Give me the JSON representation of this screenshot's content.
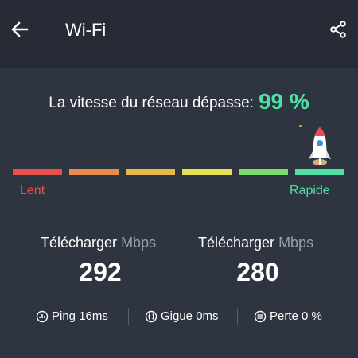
{
  "header": {
    "title": "Wi-Fi",
    "back_icon": "arrow-left-icon",
    "share_icon": "share-icon"
  },
  "speed": {
    "headline": "La vitesse du réseau dépasse:",
    "percent": "99 %",
    "percent_color": "#4fe0a6",
    "scale_min_label": "Lent",
    "scale_max_label": "Rapide",
    "segment_colors": [
      "#e8504f",
      "#e98b4c",
      "#e8b84a",
      "#e8e052",
      "#7bdc6d",
      "#4fe0a6"
    ]
  },
  "metrics": [
    {
      "label": "Télécharger",
      "unit": "Mbps",
      "value": "292"
    },
    {
      "label": "Télécharger",
      "unit": "Mbps",
      "value": "280"
    }
  ],
  "stats": [
    {
      "icon": "ping-icon",
      "text": "Ping 16ms"
    },
    {
      "icon": "jitter-icon",
      "text": "Gigue 0ms"
    },
    {
      "icon": "loss-icon",
      "text": "Perte 0 %"
    }
  ]
}
